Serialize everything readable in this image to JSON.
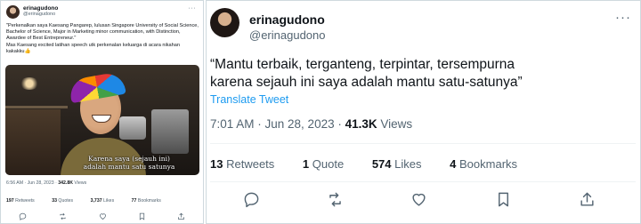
{
  "left_tweet": {
    "name": "erinagudono",
    "handle": "@erinagudono",
    "more": "···",
    "text_line1": "\"Perkenalkan saya Kaesang Pangarep, lulusan Singapore University of Social Science, Bachelor of Science, Major in Marketing minor communication, with Distinction, Awardee of Best Entrepreneur.\"",
    "text_line2": "Mas Kaesang excited latihan speech utk perkenalan keluarga di acara nikahan kakakku👍",
    "video_caption_1": "Karena saya (sejauh ini)",
    "video_caption_2": "adalah mantu satu satunya",
    "time": "6:56 AM · Jun 28, 2023 · ",
    "views": "342.8K",
    "views_label": " Views",
    "stats": {
      "retweets_count": "197",
      "retweets_label": "Retweets",
      "quotes_count": "33",
      "quotes_label": "Quotes",
      "likes_count": "3,737",
      "likes_label": "Likes",
      "bookmarks_count": "77",
      "bookmarks_label": "Bookmarks"
    }
  },
  "right_tweet": {
    "name": "erinagudono",
    "handle": "@erinagudono",
    "more": "···",
    "text_line1": "“Mantu terbaik, terganteng, terpintar, tersempurna",
    "text_line2": "karena sejauh ini saya adalah mantu satu-satunya”",
    "translate": "Translate Tweet",
    "time": "7:01 AM · Jun 28, 2023 · ",
    "views": "41.3K",
    "views_label": " Views",
    "stats": {
      "retweets_count": "13",
      "retweets_label": "Retweets",
      "quotes_count": "1",
      "quotes_label": "Quote",
      "likes_count": "574",
      "likes_label": "Likes",
      "bookmarks_count": "4",
      "bookmarks_label": "Bookmarks"
    }
  },
  "icons": [
    "reply-icon",
    "retweet-icon",
    "like-icon",
    "bookmark-icon",
    "share-icon"
  ],
  "colors": {
    "link": "#1d9bf0",
    "secondary_text": "#536471",
    "primary_text": "#0f1419",
    "border": "#cfd9de"
  }
}
